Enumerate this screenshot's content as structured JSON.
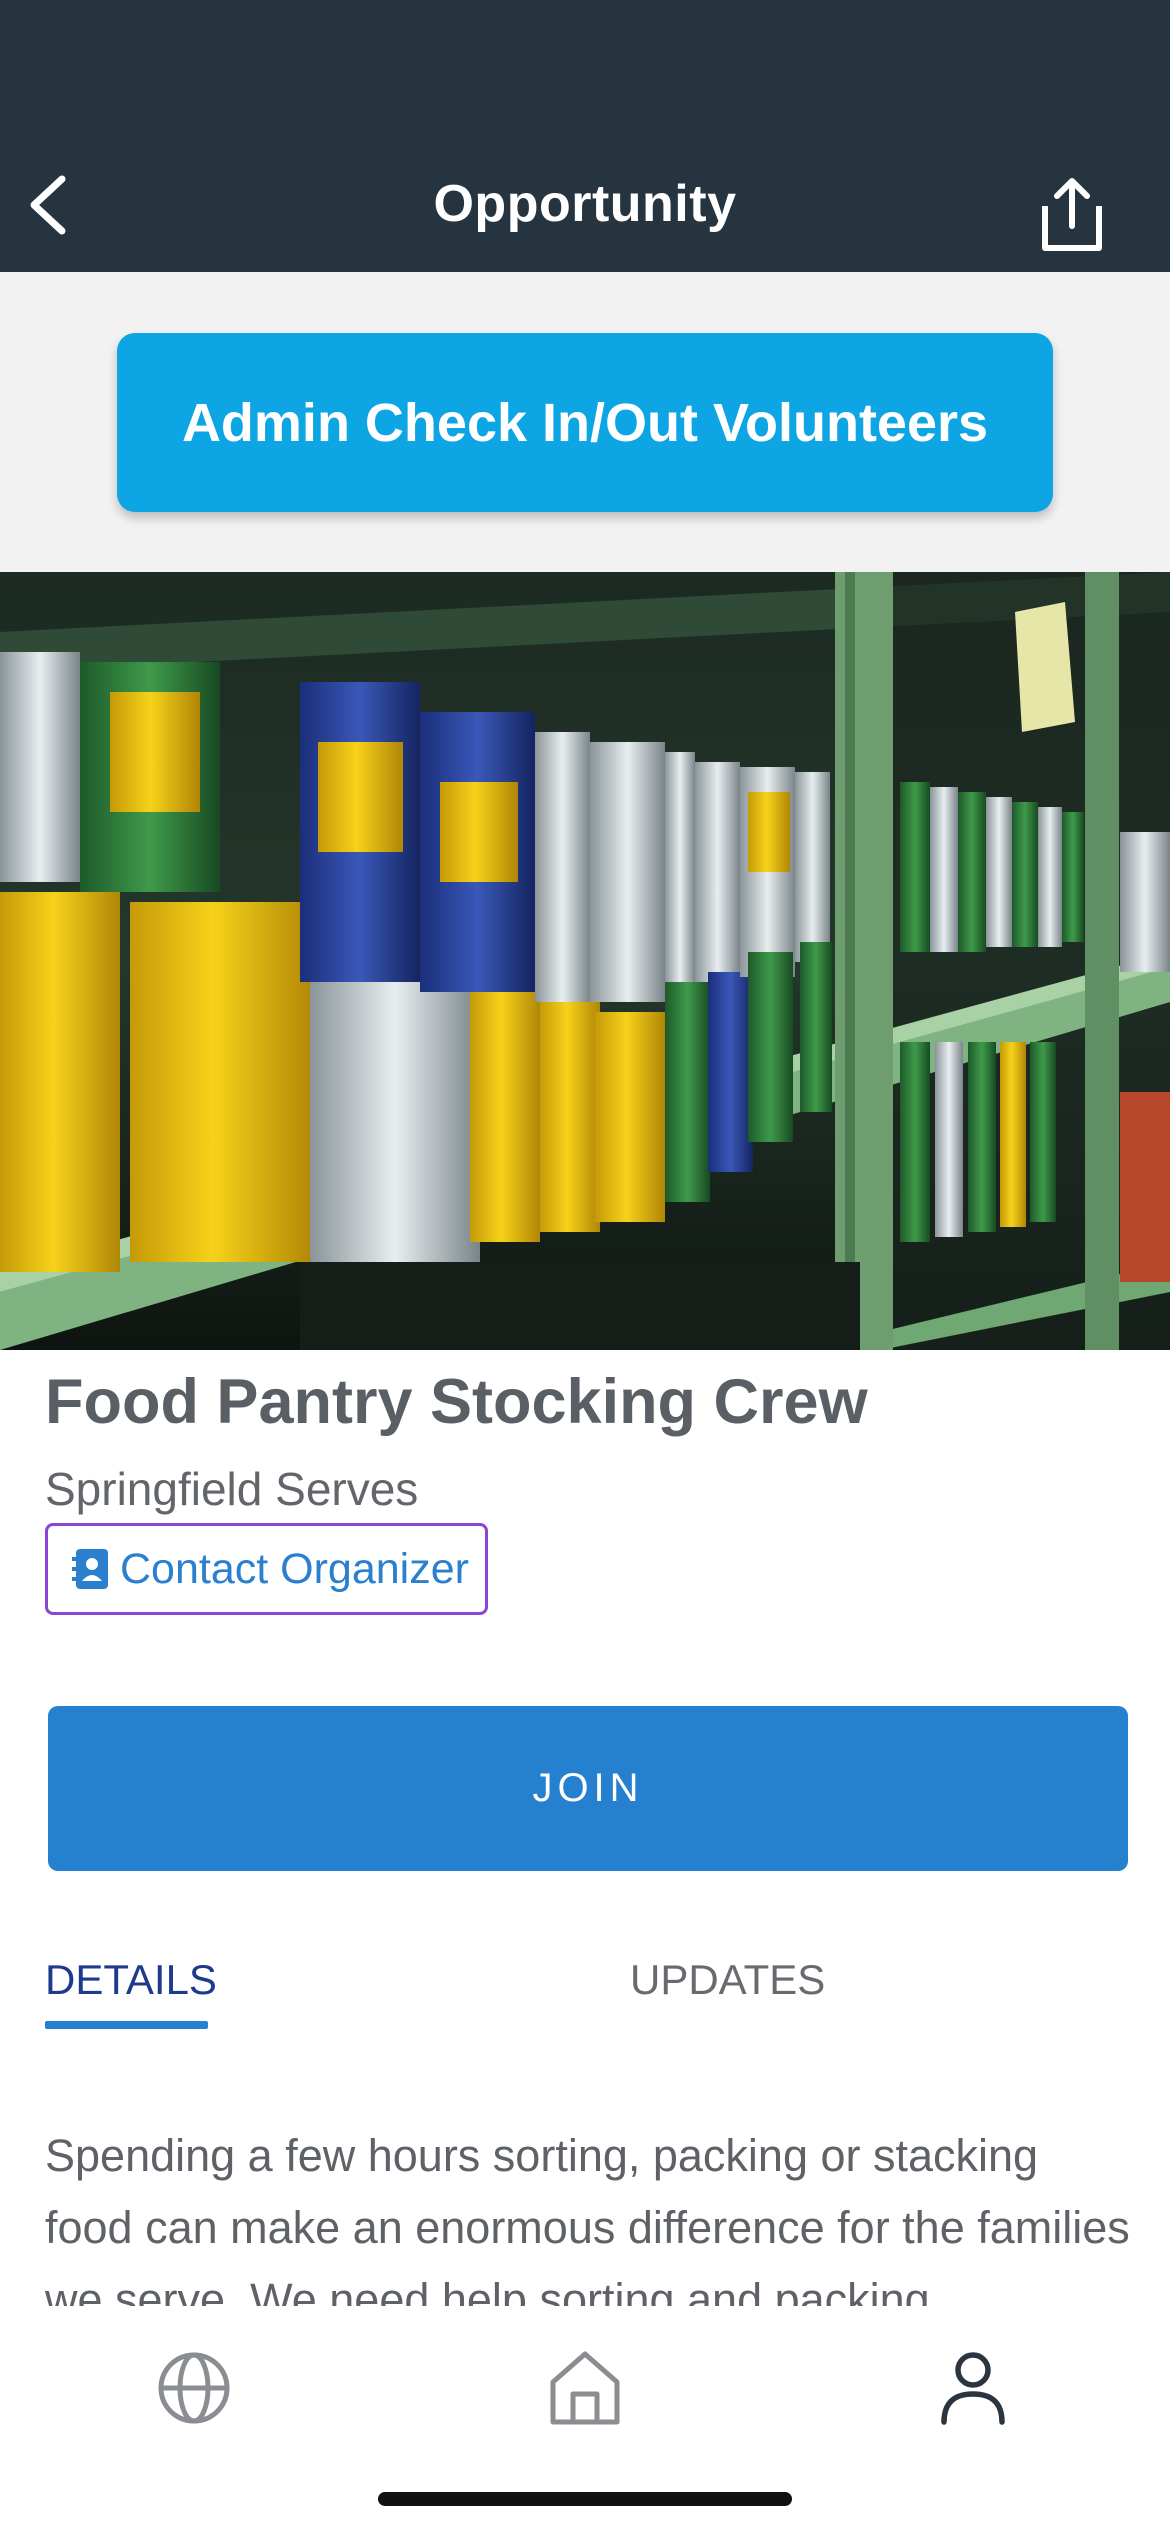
{
  "header": {
    "title": "Opportunity",
    "back_icon": "chevron-left-icon",
    "share_icon": "share-icon",
    "background": "#263440"
  },
  "admin": {
    "button_label": "Admin Check In/Out Volunteers",
    "color": "#0ea5e4"
  },
  "hero": {
    "icon": "hero-image"
  },
  "opportunity": {
    "title": "Food Pantry Stocking Crew",
    "organization": "Springfield Serves",
    "contact_label": "Contact Organizer",
    "contact_icon": "contact-card-icon",
    "join_label": "JOIN",
    "join_color": "#2580d0"
  },
  "tabs": [
    {
      "label": "DETAILS",
      "active": true
    },
    {
      "label": "UPDATES",
      "active": false
    }
  ],
  "details": {
    "description": "Spending a few hours sorting, packing or stacking food can make an enormous difference for the families we serve. We need help sorting and packing"
  },
  "bottom_nav": {
    "items": [
      {
        "icon": "globe-icon"
      },
      {
        "icon": "home-icon"
      },
      {
        "icon": "person-icon",
        "active": true
      }
    ]
  }
}
